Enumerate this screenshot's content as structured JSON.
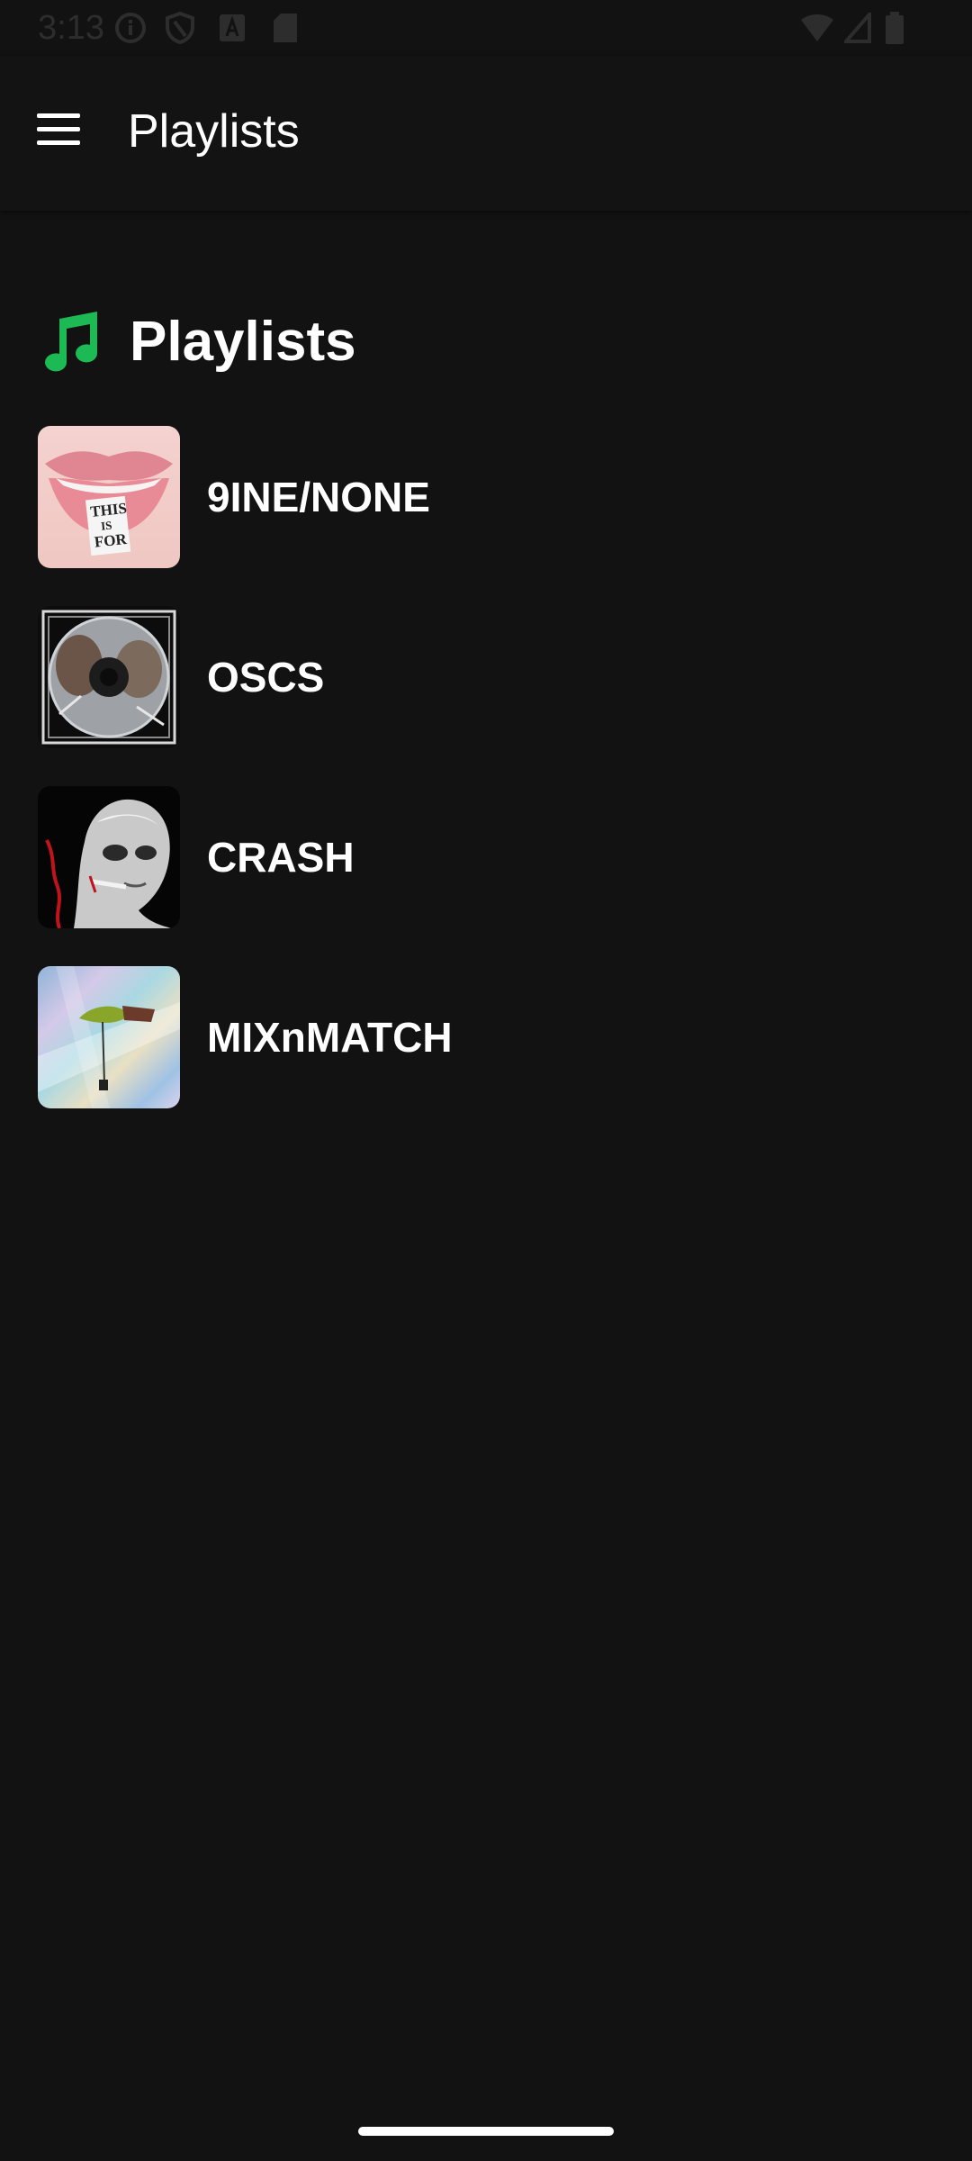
{
  "status_bar": {
    "time": "3:13"
  },
  "app_bar": {
    "title": "Playlists",
    "menu_icon": "hamburger-menu-icon"
  },
  "section": {
    "title": "Playlists",
    "icon": "music-note-icon",
    "icon_color": "#1db954"
  },
  "playlists": [
    {
      "name": "9INE/NONE",
      "cover_text": [
        "THIS",
        "IS",
        "FOR"
      ]
    },
    {
      "name": "OSCS"
    },
    {
      "name": "CRASH"
    },
    {
      "name": "MIXnMATCH"
    }
  ],
  "colors": {
    "background": "#121212",
    "app_bar": "#131313",
    "text": "#ffffff",
    "accent": "#1db954"
  }
}
